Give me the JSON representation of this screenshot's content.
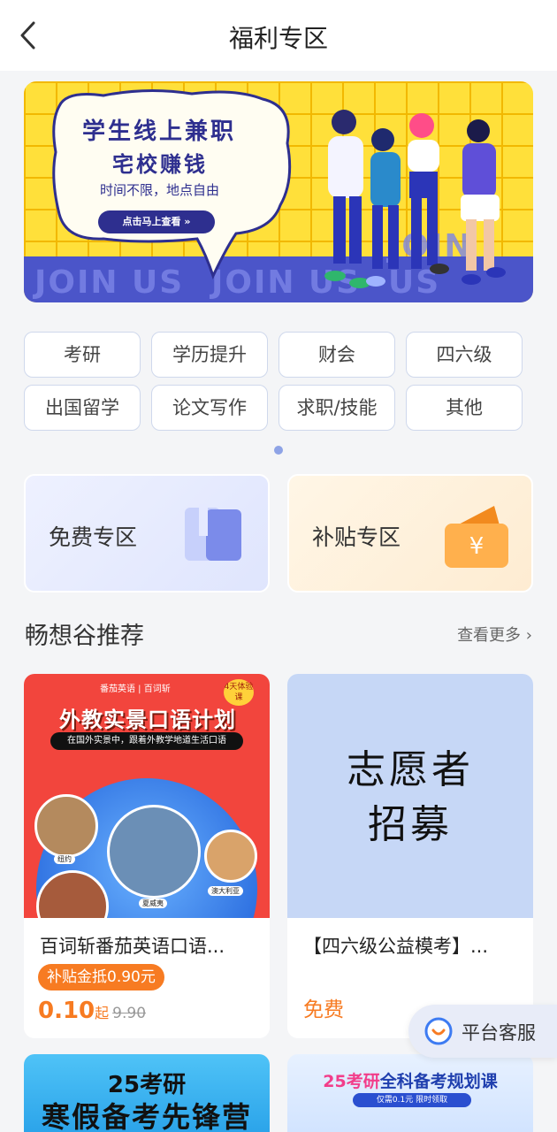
{
  "header": {
    "title": "福利专区"
  },
  "banner": {
    "headline_1": "学生线上兼职",
    "headline_2": "宅校赚钱",
    "subline": "时间不限，地点自由",
    "cta": "点击马上查看 »",
    "bg_text": "JOIN US"
  },
  "categories": [
    "考研",
    "学历提升",
    "财会",
    "四六级",
    "出国留学",
    "论文写作",
    "求职/技能",
    "其他"
  ],
  "zones": {
    "free": "免费专区",
    "subsidy": "补贴专区"
  },
  "section": {
    "title": "畅想谷推荐",
    "more": "查看更多"
  },
  "cards": [
    {
      "name": "百词斩番茄英语口语...",
      "subsidy": "补贴金抵0.90元",
      "price": "0.10",
      "price_suffix": "起",
      "original_price": "9.90",
      "image": {
        "brand_1": "番茄英语",
        "brand_2": "百词斩",
        "badge": "4天体验课",
        "headline": "外教实景口语计划",
        "subline": "在国外实景中，跟着外教学地道生活口语",
        "cities": [
          "纽约",
          "夏威夷",
          "澳大利亚"
        ]
      }
    },
    {
      "name": "【四六级公益模考】...",
      "price_label": "免费",
      "image": {
        "line_1": "志愿者",
        "line_2": "招募"
      }
    }
  ],
  "bottom_cards": [
    {
      "line_1": "25考研",
      "line_2": "寒假备考先锋营"
    },
    {
      "line_1_a": "25考研",
      "line_1_b": "全科备考规划课",
      "line_2": "仅需0.1元 限时领取"
    }
  ],
  "customer_service": {
    "label": "平台客服"
  },
  "colors": {
    "accent": "#f77b22",
    "banner_yellow": "#ffe03a",
    "banner_blue": "#4b55c9"
  }
}
